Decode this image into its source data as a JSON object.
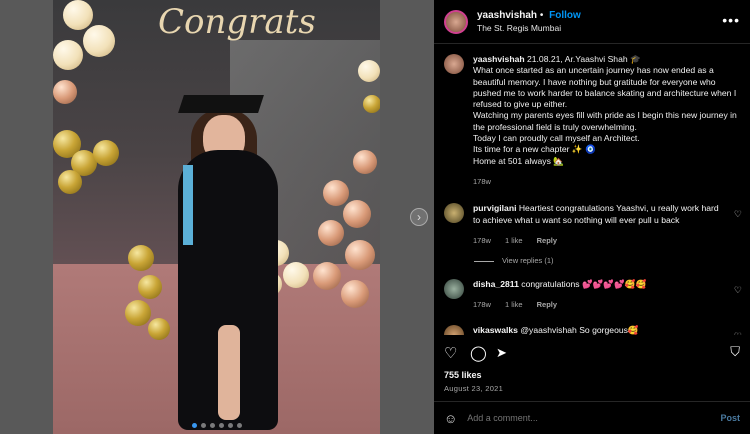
{
  "header": {
    "username": "yaashvishah",
    "separator": "•",
    "follow_label": "Follow",
    "location": "The St. Regis Mumbai",
    "more_icon": "ellipsis-icon"
  },
  "photo": {
    "sign_text": "Congrats",
    "carousel_dots": 6,
    "active_dot": 0
  },
  "caption": {
    "username": "yaashvishah",
    "text_line1": "21.08.21, Ar.Yaashvi Shah 🎓",
    "text_line2": "What once started as an uncertain journey has now ended as a beautiful memory. I have nothing but gratitude for everyone who pushed me to work harder to balance skating and architecture when I refused to give up either.",
    "text_line3": "Watching my parents eyes fill with pride as I begin this new journey in the professional field is truly overwhelming.",
    "text_line4": "Today I can proudly call myself an Architect.",
    "text_line5": "Its time for a new chapter ✨ 🧿",
    "text_line6": "Home at 501 always 🏡",
    "time": "178w"
  },
  "comments": [
    {
      "username": "purvigilani",
      "text": "Heartiest congratulations Yaashvi, u really work hard to achieve what u want so nothing will ever pull u back",
      "time": "178w",
      "likes": "1 like",
      "reply": "Reply",
      "view_replies": "View replies (1)"
    },
    {
      "username": "disha_2811",
      "text": "congratulations 💕💕💕💕🥰🥰",
      "time": "178w",
      "likes": "1 like",
      "reply": "Reply"
    },
    {
      "username": "vikaswalks",
      "text": "@yaashvishah So gorgeous🥰"
    }
  ],
  "footer": {
    "likes": "755 likes",
    "date": "August 23, 2021",
    "add_placeholder": "Add a comment...",
    "post_label": "Post"
  },
  "colors": {
    "accent": "#0095f6",
    "background": "#000000",
    "overlay": "#595959"
  }
}
